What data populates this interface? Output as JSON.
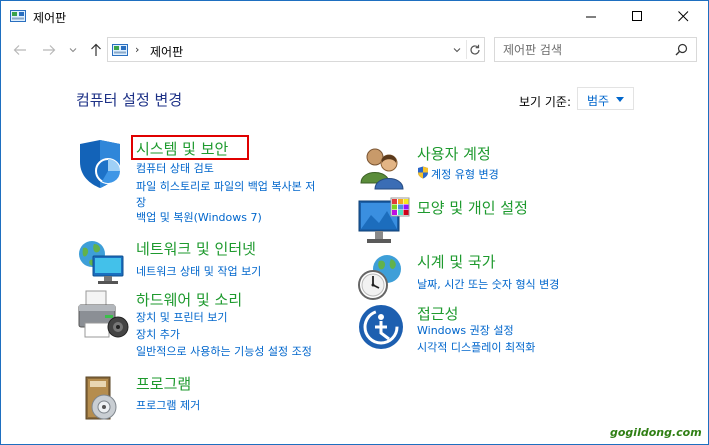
{
  "window": {
    "title": "제어판"
  },
  "address": {
    "path": "제어판",
    "search_placeholder": "제어판 검색"
  },
  "content": {
    "page_title": "컴퓨터 설정 변경",
    "view_by_label": "보기 기준:",
    "view_by_value": "범주"
  },
  "categories": {
    "system": {
      "title": "시스템 및 보안",
      "links": [
        "컴퓨터 상태 검토",
        "파일 히스토리로 파일의 백업 복사본 저",
        "장",
        "백업 및 복원(Windows 7)"
      ]
    },
    "network": {
      "title": "네트워크 및 인터넷",
      "links": [
        "네트워크 상태 및 작업 보기"
      ]
    },
    "hardware": {
      "title": "하드웨어 및 소리",
      "links": [
        "장치 및 프린터 보기",
        "장치 추가",
        "일반적으로 사용하는 기능성 설정 조정"
      ]
    },
    "programs": {
      "title": "프로그램",
      "links": [
        "프로그램 제거"
      ]
    },
    "users": {
      "title": "사용자 계정",
      "links": [
        "계정 유형 변경"
      ]
    },
    "appearance": {
      "title": "모양 및 개인 설정",
      "links": []
    },
    "clock": {
      "title": "시계 및 국가",
      "links": [
        "날짜, 시간 또는 숫자 형식 변경"
      ]
    },
    "ease": {
      "title": "접근성",
      "links": [
        "Windows 권장 설정",
        "시각적 디스플레이 최적화"
      ]
    }
  },
  "watermark": "gogildong.com",
  "colors": {
    "category_title": "#1e9a2e",
    "link": "#0066cc",
    "page_title": "#1e3287",
    "highlight": "#e00000"
  }
}
